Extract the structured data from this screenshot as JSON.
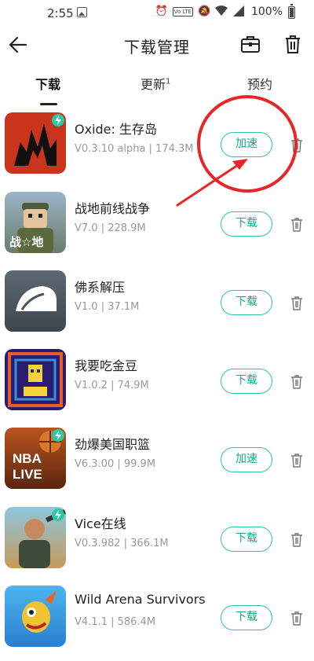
{
  "status_bar": {
    "time": "2:55",
    "battery": "100%",
    "badge": "Vo LTE"
  },
  "header": {
    "title": "下载管理"
  },
  "tabs": [
    {
      "label": "下载",
      "active": true
    },
    {
      "label": "更新",
      "sup": "1",
      "active": false
    },
    {
      "label": "预约",
      "active": false
    }
  ],
  "apps": [
    {
      "name": "Oxide: 生存岛",
      "meta": "V0.3.10 alpha | 174.3M",
      "action": "加速",
      "accelerated": true
    },
    {
      "name": "战地前线战争",
      "meta": "V7.0 | 228.9M",
      "action": "下载",
      "accelerated": false,
      "icon_text": "战☆地"
    },
    {
      "name": "佛系解压",
      "meta": "V1.0 | 37.1M",
      "action": "下载",
      "accelerated": false
    },
    {
      "name": "我要吃金豆",
      "meta": "V1.0.2 | 74.9M",
      "action": "下载",
      "accelerated": false
    },
    {
      "name": "劲爆美国职篮",
      "meta": "V6.3.00 | 99.9M",
      "action": "加速",
      "accelerated": true,
      "icon_text_1": "NBA",
      "icon_text_2": "LIVE"
    },
    {
      "name": "Vice在线",
      "meta": "V0.3.982 | 366.1M",
      "action": "下载",
      "accelerated": false
    },
    {
      "name": "Wild Arena Survivors",
      "meta": "V4.1.1 | 586.4M",
      "action": "下载",
      "accelerated": false
    }
  ],
  "colors": {
    "accent": "#2ec6a6",
    "annotation": "#e8262a"
  }
}
